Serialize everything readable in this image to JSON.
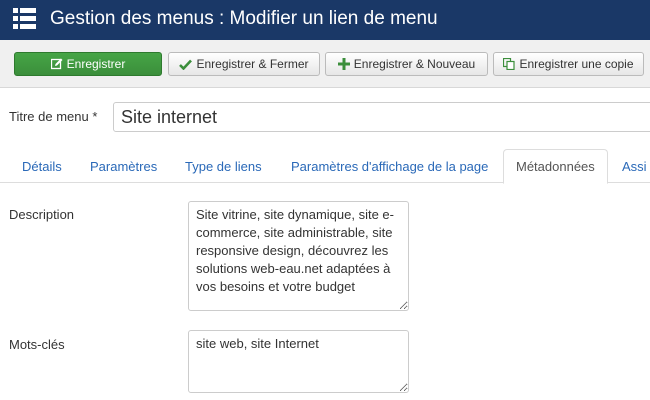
{
  "header": {
    "title": "Gestion des menus : Modifier un lien de menu",
    "icon": "list-menu-icon",
    "background": "#1a3867"
  },
  "toolbar": {
    "save_label": "Enregistrer",
    "save_close_label": "Enregistrer & Fermer",
    "save_new_label": "Enregistrer & Nouveau",
    "save_copy_label": "Enregistrer une copie",
    "save_color": "#46a546"
  },
  "title_field": {
    "label": "Titre de menu *",
    "value": "Site internet"
  },
  "tabs": [
    {
      "label": "Détails"
    },
    {
      "label": "Paramètres"
    },
    {
      "label": "Type de liens"
    },
    {
      "label": "Paramètres d'affichage de la page"
    },
    {
      "label": "Métadonnées"
    },
    {
      "label": "Assi"
    }
  ],
  "active_tab": "Métadonnées",
  "fields": {
    "description_label": "Description",
    "description_value": "Site vitrine, site dynamique, site e-commerce, site administrable, site responsive design, découvrez les solutions web-eau.net adaptées à vos besoins et votre budget",
    "keywords_label": "Mots-clés",
    "keywords_value": "site web, site Internet"
  },
  "link_color": "#2a69b8"
}
